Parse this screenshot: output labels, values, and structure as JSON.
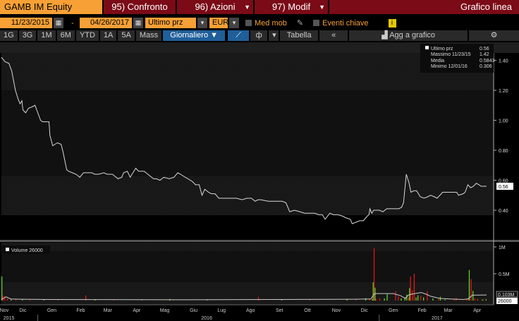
{
  "header": {
    "ticker": "GAMB IM Equity",
    "compare": "95) Confronto",
    "actions": "96) Azioni",
    "modify": "97) Modif",
    "chart_type": "Grafico linea"
  },
  "controls": {
    "start_date": "11/23/2015",
    "dash": "-",
    "end_date": "04/26/2017",
    "field": "Ultimo prz",
    "currency": "EUR",
    "moving_avg": "Med mob",
    "key_events": "Eventi chiave",
    "info": "i"
  },
  "periods": [
    "1G",
    "3G",
    "1M",
    "6M",
    "YTD",
    "1A",
    "5A",
    "Mass"
  ],
  "frequency": "Giornaliero ▼",
  "toolbar": {
    "table": "Tabella",
    "collapse": "«",
    "add_to_chart": "Agg a grafico"
  },
  "legend": {
    "rows": [
      {
        "label": "Ultimo prz",
        "value": "0.56"
      },
      {
        "label": "Massimo 11/23/15",
        "value": "1.42"
      },
      {
        "label": "Media",
        "value": "0.5843"
      },
      {
        "label": "Minimo 12/01/16",
        "value": "0.306"
      }
    ]
  },
  "volume_legend": "Volume 26000",
  "colors": {
    "orange": "#f7a035",
    "red": "#7a0b17",
    "up": "#5fd32a",
    "down": "#e01818"
  },
  "chart_data": [
    {
      "type": "line",
      "title": "GAMB IM Equity - Ultimo prz",
      "x_unit": "days since 11/23/2015",
      "ylim": [
        0.24,
        1.5
      ],
      "yticks": [
        "1.40",
        "1.20",
        "1.00",
        "0.80",
        "0.60",
        "0.40"
      ],
      "ytick_values": [
        1.4,
        1.2,
        1.0,
        0.8,
        0.6,
        0.4
      ],
      "last_label": "0.56",
      "x": [
        0,
        4,
        8,
        11,
        15,
        18,
        20,
        22,
        23,
        26,
        29,
        33,
        36,
        39,
        42,
        44,
        51,
        52,
        55,
        60,
        64,
        66,
        70,
        72,
        76,
        80,
        84,
        88,
        91,
        97,
        100,
        104,
        110,
        113,
        119,
        125,
        129,
        131,
        135,
        138,
        140,
        144,
        147,
        153,
        159,
        163,
        166,
        170,
        174,
        180,
        185,
        189,
        192,
        197,
        200,
        205,
        208,
        212,
        215,
        218,
        222,
        225,
        229,
        233,
        235,
        240,
        248,
        252,
        258,
        263,
        268,
        272,
        275,
        278,
        286,
        291,
        301,
        305,
        309,
        314,
        320,
        325,
        331,
        336,
        340,
        344,
        347,
        352,
        356,
        361,
        366,
        369,
        374,
        376,
        380,
        384,
        388,
        392,
        394,
        395,
        397,
        399,
        405,
        409,
        413,
        418,
        422,
        426,
        429,
        431,
        434,
        437,
        439,
        442,
        445,
        449,
        453,
        457,
        460,
        464,
        467,
        470,
        473,
        476,
        480,
        484,
        488,
        490,
        495,
        497,
        500,
        503,
        506,
        509,
        512,
        514,
        520
      ],
      "y": [
        1.42,
        1.39,
        1.38,
        1.33,
        1.2,
        1.14,
        1.11,
        1.13,
        1.07,
        1.05,
        1.08,
        1.09,
        1.1,
        1.05,
        1.0,
        0.99,
        0.99,
        0.9,
        0.83,
        0.85,
        0.84,
        0.79,
        0.67,
        0.66,
        0.65,
        0.64,
        0.62,
        0.65,
        0.65,
        0.65,
        0.64,
        0.64,
        0.65,
        0.64,
        0.64,
        0.61,
        0.62,
        0.65,
        0.66,
        0.62,
        0.64,
        0.68,
        0.66,
        0.66,
        0.63,
        0.61,
        0.61,
        0.6,
        0.62,
        0.61,
        0.62,
        0.65,
        0.64,
        0.62,
        0.61,
        0.59,
        0.57,
        0.57,
        0.5,
        0.54,
        0.52,
        0.51,
        0.51,
        0.48,
        0.48,
        0.48,
        0.48,
        0.48,
        0.47,
        0.48,
        0.48,
        0.46,
        0.47,
        0.47,
        0.46,
        0.46,
        0.46,
        0.45,
        0.39,
        0.4,
        0.39,
        0.38,
        0.38,
        0.38,
        0.37,
        0.37,
        0.34,
        0.38,
        0.37,
        0.37,
        0.36,
        0.35,
        0.34,
        0.31,
        0.32,
        0.33,
        0.33,
        0.36,
        0.37,
        0.41,
        0.38,
        0.4,
        0.4,
        0.39,
        0.41,
        0.41,
        0.41,
        0.41,
        0.42,
        0.45,
        0.64,
        0.58,
        0.52,
        0.53,
        0.53,
        0.49,
        0.48,
        0.49,
        0.5,
        0.49,
        0.48,
        0.5,
        0.52,
        0.52,
        0.52,
        0.52,
        0.52,
        0.5,
        0.51,
        0.52,
        0.57,
        0.55,
        0.56,
        0.58,
        0.57,
        0.56,
        0.56
      ]
    },
    {
      "type": "bar",
      "title": "Volume",
      "ylim": [
        0,
        1050000
      ],
      "yticks": [
        "1M",
        "0.5M"
      ],
      "ytick_values": [
        1000000,
        500000
      ],
      "ma_label": "0.103M",
      "last_label": "26000",
      "bars": [
        [
          0,
          450000,
          "up"
        ],
        [
          1,
          90000,
          "down"
        ],
        [
          3,
          80000,
          "down"
        ],
        [
          6,
          40000,
          "down"
        ],
        [
          10,
          30000,
          "up"
        ],
        [
          15,
          25000,
          "down"
        ],
        [
          22,
          20000,
          "up"
        ],
        [
          30,
          15000,
          "down"
        ],
        [
          45,
          20000,
          "up"
        ],
        [
          60,
          15000,
          "down"
        ],
        [
          90,
          95000,
          "down"
        ],
        [
          100,
          15000,
          "up"
        ],
        [
          120,
          12000,
          "down"
        ],
        [
          150,
          10000,
          "up"
        ],
        [
          180,
          30000,
          "up"
        ],
        [
          184,
          20000,
          "down"
        ],
        [
          220,
          15000,
          "up"
        ],
        [
          275,
          70000,
          "down"
        ],
        [
          300,
          20000,
          "up"
        ],
        [
          330,
          15000,
          "down"
        ],
        [
          370,
          25000,
          "up"
        ],
        [
          380,
          15000,
          "down"
        ],
        [
          405,
          40000,
          "down"
        ],
        [
          410,
          30000,
          "down"
        ],
        [
          428,
          35000,
          "up"
        ],
        [
          440,
          50000,
          "up"
        ],
        [
          470,
          70000,
          "up"
        ],
        [
          487,
          50000,
          "down"
        ],
        [
          500,
          40000,
          "down"
        ],
        [
          510,
          30000,
          "up"
        ],
        [
          516,
          20000,
          "down"
        ],
        [
          390,
          45000,
          "up"
        ],
        [
          394,
          40000,
          "down"
        ],
        [
          397,
          20000,
          "up"
        ],
        [
          398,
          340000,
          "up"
        ],
        [
          399,
          980000,
          "down"
        ],
        [
          400,
          240000,
          "up"
        ],
        [
          401,
          30000,
          "down"
        ],
        [
          410,
          40000,
          "up"
        ],
        [
          413,
          120000,
          "up"
        ],
        [
          422,
          170000,
          "down"
        ],
        [
          425,
          80000,
          "down"
        ],
        [
          428,
          40000,
          "up"
        ],
        [
          432,
          60000,
          "up"
        ],
        [
          434,
          110000,
          "up"
        ],
        [
          436,
          60000,
          "down"
        ],
        [
          437,
          230000,
          "up"
        ],
        [
          438,
          450000,
          "down"
        ],
        [
          440,
          190000,
          "down"
        ],
        [
          442,
          500000,
          "down"
        ],
        [
          444,
          60000,
          "up"
        ],
        [
          446,
          100000,
          "up"
        ],
        [
          449,
          90000,
          "down"
        ],
        [
          452,
          60000,
          "up"
        ],
        [
          456,
          170000,
          "down"
        ],
        [
          462,
          40000,
          "up"
        ],
        [
          468,
          30000,
          "down"
        ],
        [
          475,
          20000,
          "up"
        ],
        [
          485,
          20000,
          "down"
        ],
        [
          498,
          30000,
          "down"
        ],
        [
          501,
          570000,
          "up"
        ],
        [
          503,
          400000,
          "down"
        ],
        [
          505,
          180000,
          "up"
        ],
        [
          507,
          40000,
          "down"
        ],
        [
          510,
          25000,
          "down"
        ],
        [
          515,
          20000,
          "up"
        ],
        [
          519,
          26000,
          "up"
        ]
      ],
      "ma_x": [
        0,
        5,
        10,
        20,
        50,
        100,
        200,
        300,
        380,
        396,
        400,
        420,
        428,
        433,
        436,
        440,
        450,
        455,
        460,
        470,
        480,
        495,
        500,
        505,
        520
      ],
      "ma_y": [
        20000,
        70000,
        30000,
        25000,
        20000,
        18000,
        15000,
        20000,
        25000,
        30000,
        130000,
        130000,
        90000,
        40000,
        100000,
        120000,
        150000,
        120000,
        80000,
        40000,
        30000,
        20000,
        30000,
        100000,
        103000
      ]
    },
    {
      "type": "axis",
      "months": [
        {
          "l": "Nov",
          "d": 3
        },
        {
          "l": "Dic",
          "d": 23
        },
        {
          "l": "Gen",
          "d": 54
        },
        {
          "l": "Feb",
          "d": 85
        },
        {
          "l": "Mar",
          "d": 114
        },
        {
          "l": "Apr",
          "d": 145
        },
        {
          "l": "Mag",
          "d": 175
        },
        {
          "l": "Giu",
          "d": 206
        },
        {
          "l": "Lug",
          "d": 236
        },
        {
          "l": "Ago",
          "d": 267
        },
        {
          "l": "Set",
          "d": 298
        },
        {
          "l": "Ott",
          "d": 328
        },
        {
          "l": "Nov",
          "d": 359
        },
        {
          "l": "Dic",
          "d": 389
        },
        {
          "l": "Gen",
          "d": 420
        },
        {
          "l": "Feb",
          "d": 451
        },
        {
          "l": "Mar",
          "d": 479
        },
        {
          "l": "Apr",
          "d": 510
        }
      ],
      "years": [
        {
          "l": "2015",
          "d": 8
        },
        {
          "l": "2016",
          "d": 220
        },
        {
          "l": "2017",
          "d": 467
        }
      ],
      "year_breaks": [
        39,
        405
      ]
    }
  ]
}
